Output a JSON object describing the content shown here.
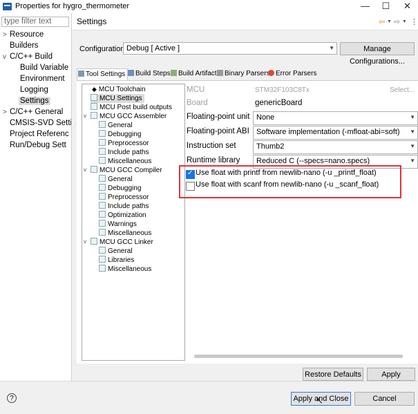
{
  "window": {
    "title": "Properties for hygro_thermometer",
    "minimize": "—",
    "maximize": "☐",
    "close": "✕"
  },
  "filter": {
    "placeholder": "type filter text"
  },
  "nav": {
    "items": [
      {
        "label": "Resource",
        "twisty": ">"
      },
      {
        "label": "Builders",
        "twisty": ""
      },
      {
        "label": "C/C++ Build",
        "twisty": "v"
      },
      {
        "label": "Build Variable",
        "twisty": ""
      },
      {
        "label": "Environment",
        "twisty": ""
      },
      {
        "label": "Logging",
        "twisty": ""
      },
      {
        "label": "Settings",
        "twisty": ""
      },
      {
        "label": "C/C++ General",
        "twisty": ">"
      },
      {
        "label": "CMSIS-SVD Setti",
        "twisty": ""
      },
      {
        "label": "Project Referenc",
        "twisty": ""
      },
      {
        "label": "Run/Debug Sett",
        "twisty": ""
      }
    ]
  },
  "header": {
    "title": "Settings",
    "back_icon": "⇦",
    "forward_icon": "⇨",
    "menu_icon": "⋮"
  },
  "configuration": {
    "label": "Configuration:",
    "value": "Debug  [ Active ]",
    "manage_button": "Manage Configurations..."
  },
  "tabs": [
    {
      "label": "Tool Settings",
      "active": true
    },
    {
      "label": "Build Steps",
      "active": false
    },
    {
      "label": "Build Artifact",
      "active": false
    },
    {
      "label": "Binary Parsers",
      "active": false
    },
    {
      "label": "Error Parsers",
      "active": false
    }
  ],
  "tool_tree": [
    {
      "label": "MCU Toolchain",
      "level": 1
    },
    {
      "label": "MCU Settings",
      "level": 1
    },
    {
      "label": "MCU Post build outputs",
      "level": 1
    },
    {
      "label": "MCU GCC Assembler",
      "level": 1
    },
    {
      "label": "General",
      "level": 2
    },
    {
      "label": "Debugging",
      "level": 2
    },
    {
      "label": "Preprocessor",
      "level": 2
    },
    {
      "label": "Include paths",
      "level": 2
    },
    {
      "label": "Miscellaneous",
      "level": 2
    },
    {
      "label": "MCU GCC Compiler",
      "level": 1
    },
    {
      "label": "General",
      "level": 2
    },
    {
      "label": "Debugging",
      "level": 2
    },
    {
      "label": "Preprocessor",
      "level": 2
    },
    {
      "label": "Include paths",
      "level": 2
    },
    {
      "label": "Optimization",
      "level": 2
    },
    {
      "label": "Warnings",
      "level": 2
    },
    {
      "label": "Miscellaneous",
      "level": 2
    },
    {
      "label": "MCU GCC Linker",
      "level": 1
    },
    {
      "label": "General",
      "level": 2
    },
    {
      "label": "Libraries",
      "level": 2
    },
    {
      "label": "Miscellaneous",
      "level": 2
    }
  ],
  "mcu_settings": {
    "mcu": {
      "label": "MCU",
      "value": "STM32F103C8Tx",
      "select_button": "Select..."
    },
    "board": {
      "label": "Board",
      "value": "genericBoard"
    },
    "fpu": {
      "label": "Floating-point unit",
      "value": "None"
    },
    "fabi": {
      "label": "Floating-point ABI",
      "value": "Software implementation (-mfloat-abi=soft)"
    },
    "iset": {
      "label": "Instruction set",
      "value": "Thumb2"
    },
    "rtlib": {
      "label": "Runtime library",
      "value": "Reduced C (--specs=nano.specs)"
    },
    "printf_float": {
      "label": "Use float with printf from newlib-nano (-u _printf_float)",
      "checked": true
    },
    "scanf_float": {
      "label": "Use float with scanf from newlib-nano (-u _scanf_float)",
      "checked": false
    }
  },
  "buttons": {
    "restore_defaults": "Restore Defaults",
    "apply": "Apply",
    "apply_close": "Apply and Close",
    "cancel": "Cancel",
    "help": "?"
  }
}
